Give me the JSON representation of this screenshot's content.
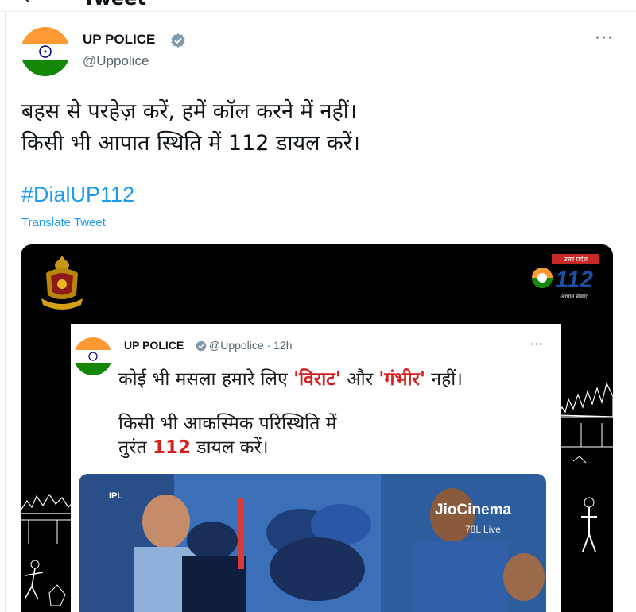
{
  "header": {
    "back_icon": "arrow-left-icon",
    "title": "Tweet"
  },
  "tweet": {
    "author_name": "UP POLICE",
    "author_handle": "@Uppolice",
    "verified_icon": "verified-badge-icon",
    "more_icon": "more-options-icon",
    "text_lines": [
      "बहस से परहेज़ करें, हमें कॉल करने में नहीं।",
      "किसी भी आपात स्थिति में 112 डायल करें।"
    ],
    "hashtag": "#DialUP112",
    "translate_label": "Translate Tweet"
  },
  "media": {
    "logo_top": "उत्तर प्रदेश",
    "logo_number": "112",
    "logo_bottom": "आपात सेवाएं",
    "inner_tweet": {
      "author_name": "UP POLICE",
      "author_handle": "@Uppolice · 12h",
      "line1_a": "कोई भी मसला हमारे लिए ",
      "line1_b": "'विराट'",
      "line1_c": " और ",
      "line1_d": "'गंभीर'",
      "line1_e": " नहीं।",
      "line2": "किसी भी आकस्मिक परिस्थिति में",
      "line3_a": "तुरंत ",
      "line3_b": "112",
      "line3_c": " डायल करें।"
    },
    "video": {
      "watermark": "JioCinema",
      "views": "78L Live",
      "corner_logo": "IPL"
    }
  },
  "colors": {
    "link": "#1d9bf0",
    "secondary_text": "#536471",
    "accent_red": "#d62020",
    "saffron": "#ff9933",
    "green": "#138808"
  }
}
